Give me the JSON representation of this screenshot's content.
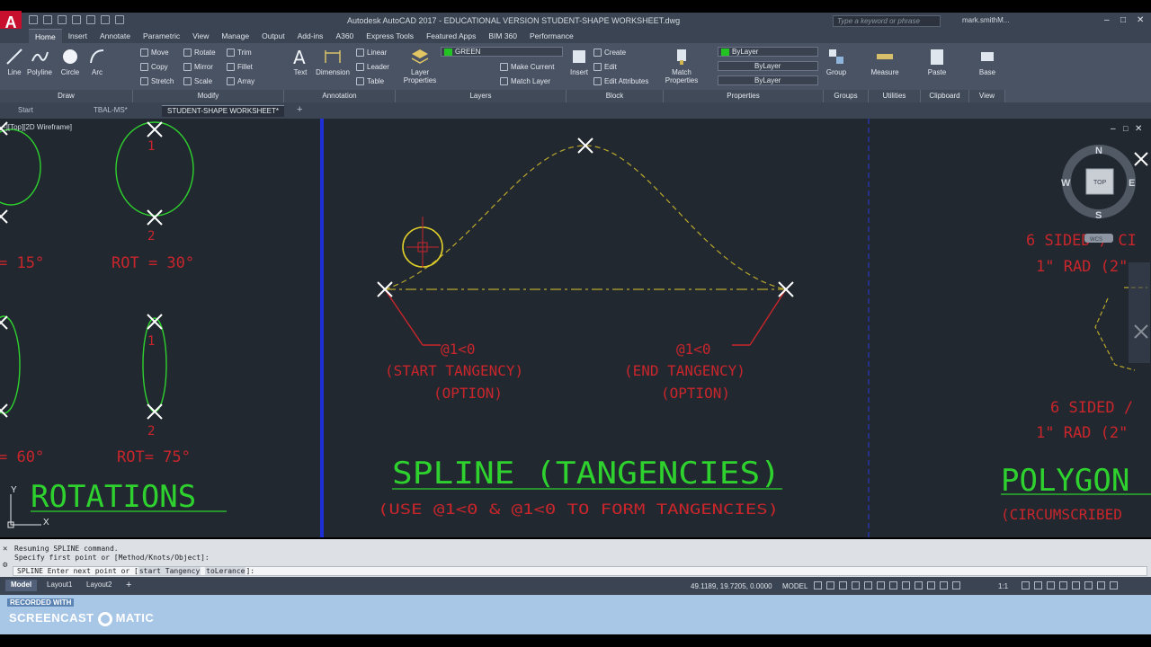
{
  "titlebar": {
    "app_title": "Autodesk AutoCAD 2017 - EDUCATIONAL VERSION    STUDENT-SHAPE WORKSHEET.dwg",
    "search_placeholder": "Type a keyword or phrase",
    "user": "mark.smithM...",
    "logo": "A"
  },
  "ribbon_tabs": [
    "Home",
    "Insert",
    "Annotate",
    "Parametric",
    "View",
    "Manage",
    "Output",
    "Add-ins",
    "A360",
    "Express Tools",
    "Featured Apps",
    "BIM 360",
    "Performance"
  ],
  "ribbon": {
    "draw": {
      "title": "Draw",
      "line": "Line",
      "polyline": "Polyline",
      "circle": "Circle",
      "arc": "Arc"
    },
    "modify": {
      "title": "Modify",
      "move": "Move",
      "rotate": "Rotate",
      "trim": "Trim",
      "copy": "Copy",
      "mirror": "Mirror",
      "fillet": "Fillet",
      "stretch": "Stretch",
      "scale": "Scale",
      "array": "Array"
    },
    "annotation": {
      "title": "Annotation",
      "text": "Text",
      "dimension": "Dimension",
      "linear": "Linear",
      "leader": "Leader",
      "table": "Table"
    },
    "layers": {
      "title": "Layers",
      "layer_properties": "Layer Properties",
      "current_layer": "GREEN",
      "make_current": "Make Current",
      "match_layer": "Match Layer"
    },
    "block": {
      "title": "Block",
      "insert": "Insert",
      "create": "Create",
      "edit": "Edit",
      "edit_attributes": "Edit Attributes"
    },
    "properties": {
      "title": "Properties",
      "match_properties": "Match Properties",
      "color": "ByLayer",
      "linetype": "ByLayer",
      "lineweight": "ByLayer"
    },
    "groups": {
      "title": "Groups",
      "group": "Group"
    },
    "utilities": {
      "title": "Utilities",
      "measure": "Measure"
    },
    "clipboard": {
      "title": "Clipboard",
      "paste": "Paste"
    },
    "view": {
      "title": "View",
      "base": "Base"
    }
  },
  "doc_tabs": [
    "Start",
    "TBAL-MS*",
    "STUDENT-SHAPE WORKSHEET*"
  ],
  "viewport_label": "-][Top][2D Wireframe]",
  "drawing": {
    "left_panel": {
      "point1": "1",
      "point2": "2",
      "rot_15": "= 15°",
      "rot_30": "ROT = 30°",
      "rot_60": "= 60°",
      "rot_75": "ROT= 75°",
      "title": "ROTATIONS"
    },
    "center_panel": {
      "start_coord": "@1<0",
      "start_label": "(START TANGENCY)",
      "start_option": "(OPTION)",
      "end_coord": "@1<0",
      "end_label": "(END TANGENCY)",
      "end_option": "(OPTION)",
      "title": "SPLINE (TANGENCIES)",
      "subtitle": "(USE @1<0 & @1<0 TO FORM TANGENCIES)"
    },
    "right_panel": {
      "line1": "6 SIDED / CI",
      "line2": "1\" RAD (2\"",
      "line3": "6 SIDED /",
      "line4": "1\" RAD (2\"",
      "title": "POLYGON",
      "subtitle": "(CIRCUMSCRIBED"
    },
    "viewcube": {
      "n": "N",
      "s": "S",
      "e": "E",
      "w": "W",
      "top": "TOP",
      "wcs": "WCS"
    },
    "ucs_x": "X",
    "ucs_y": "Y",
    "colors": {
      "background": "#212830",
      "red": "#c8262b",
      "green": "#2ed12e",
      "yellow": "#b9a72c",
      "blue": "#1f2fd6"
    }
  },
  "command": {
    "history1": "Resuming SPLINE command.",
    "history2": "Specify first point or [Method/Knots/Object]:",
    "prompt_prefix": "SPLINE Enter next point or [",
    "opt1": "start Tangency",
    "opt2": "toLerance",
    "prompt_suffix": "]:"
  },
  "status": {
    "layouts": [
      "Model",
      "Layout1",
      "Layout2"
    ],
    "coords": "49.1189, 19.7205, 0.0000",
    "model": "MODEL",
    "scale": "1:1"
  },
  "watermark": {
    "recorded": "RECORDED WITH",
    "brand_a": "SCREENCAST",
    "brand_b": "MATIC"
  }
}
